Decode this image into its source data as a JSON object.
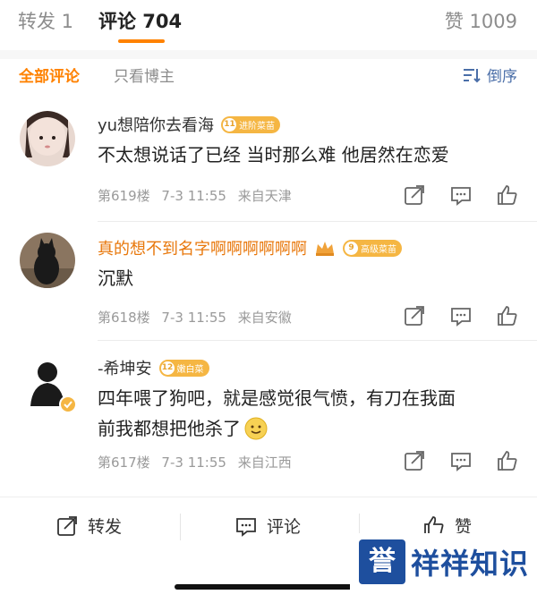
{
  "tabs": {
    "repost": "转发 1",
    "comment": "评论 704",
    "like": "赞 1009"
  },
  "filters": {
    "all": "全部评论",
    "owner_only": "只看博主",
    "sort": "倒序"
  },
  "comments": [
    {
      "user": "yu想陪你去看海",
      "badge_level": "11",
      "badge_text": "进阶菜苗",
      "text": "不太想说话了已经 当时那么难 他居然在恋爱",
      "floor": "第619楼",
      "date": "7-3 11:55",
      "location": "来自天津"
    },
    {
      "user": "真的想不到名字啊啊啊啊啊啊",
      "badge_level": "9",
      "badge_text": "高级菜苗",
      "text": "沉默",
      "floor": "第618楼",
      "date": "7-3 11:55",
      "location": "来自安徽"
    },
    {
      "user": "-希坤安",
      "badge_level": "12",
      "badge_text": "嫩白菜",
      "text_line1": "四年喂了狗吧，就是感觉很气愤，有刀在我面",
      "text_line2": "前我都想把他杀了",
      "floor": "第617楼",
      "date": "7-3 11:55",
      "location": "来自江西"
    }
  ],
  "bottom": {
    "repost": "转发",
    "comment": "评论",
    "like": "赞"
  },
  "watermark": {
    "logo": "誉",
    "text": "祥祥知识"
  },
  "colors": {
    "accent": "#ff8200",
    "link": "#4a6ea8",
    "vip_name": "#e8780c",
    "badge": "#f5b643",
    "watermark": "#1e4f9e"
  }
}
